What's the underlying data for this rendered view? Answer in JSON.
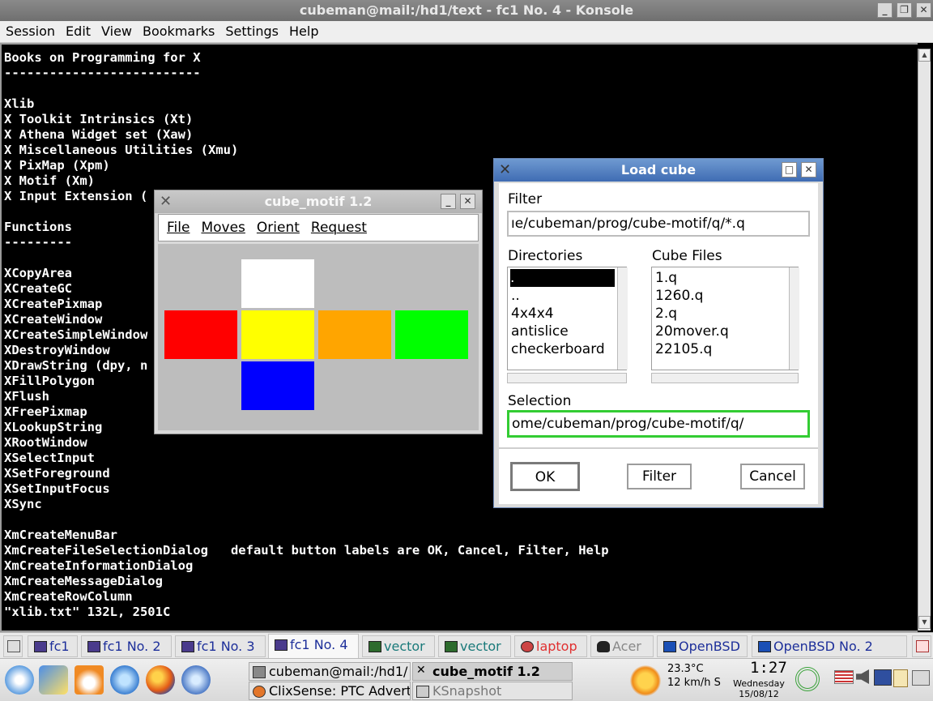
{
  "konsole": {
    "title": "cubeman@mail:/hd1/text - fc1 No. 4 - Konsole",
    "menu": [
      "Session",
      "Edit",
      "View",
      "Bookmarks",
      "Settings",
      "Help"
    ],
    "lines": [
      "Books on Programming for X",
      "--------------------------",
      "",
      "Xlib",
      "X Toolkit Intrinsics (Xt)",
      "X Athena Widget set (Xaw)",
      "X Miscellaneous Utilities (Xmu)",
      "X PixMap (Xpm)",
      "X Motif (Xm)",
      "X Input Extension (",
      "",
      "Functions",
      "---------",
      "",
      "XCopyArea",
      "XCreateGC",
      "XCreatePixmap",
      "XCreateWindow",
      "XCreateSimpleWindow",
      "XDestroyWindow",
      "XDrawString (dpy, n",
      "XFillPolygon",
      "XFlush",
      "XFreePixmap",
      "XLookupString",
      "XRootWindow",
      "XSelectInput",
      "XSetForeground",
      "XSetInputFocus",
      "XSync",
      "",
      "XmCreateMenuBar",
      "XmCreateFileSelectionDialog   default button labels are OK, Cancel, Filter, Help",
      "XmCreateInformationDialog",
      "XmCreateMessageDialog",
      "XmCreateRowColumn",
      "\"xlib.txt\" 132L, 2501C"
    ]
  },
  "cube_window": {
    "title": "cube_motif 1.2",
    "menu": [
      "File",
      "Moves",
      "Orient",
      "Request"
    ],
    "faces": {
      "top": "#ffffff",
      "left": "#ff0000",
      "front": "#ffff00",
      "right": "#ffa500",
      "back": "#00ff00",
      "bottom": "#0000ff"
    }
  },
  "dialog": {
    "title": "Load cube",
    "filter_label": "Filter",
    "filter_value": "ıe/cubeman/prog/cube-motif/q/*.q",
    "directories_label": "Directories",
    "directories": [
      ".",
      "..",
      "4x4x4",
      "antislice",
      "checkerboard"
    ],
    "files_label": "Cube Files",
    "files": [
      "1.q",
      "1260.q",
      "2.q",
      "20mover.q",
      "22105.q"
    ],
    "selection_label": "Selection",
    "selection_value": "ome/cubeman/prog/cube-motif/q/",
    "ok": "OK",
    "filter_button": "Filter",
    "cancel": "Cancel",
    "focus_color": "#33cc33"
  },
  "taskbar": {
    "tabs": [
      "fc1",
      "fc1 No. 2",
      "fc1 No. 3",
      "fc1 No. 4",
      "vector",
      "vector",
      "laptop",
      "Acer",
      "OpenBSD",
      "OpenBSD No. 2"
    ],
    "tasks": [
      "cubeman@mail:/hd1/",
      "cube_motif 1.2",
      "ClixSense: PTC Advert",
      "KSnapshot"
    ],
    "weather_temp": "23.3°C",
    "weather_wind": "12 km/h S",
    "clock_time": "1:27",
    "clock_day": "Wednesday",
    "clock_date": "15/08/12"
  }
}
